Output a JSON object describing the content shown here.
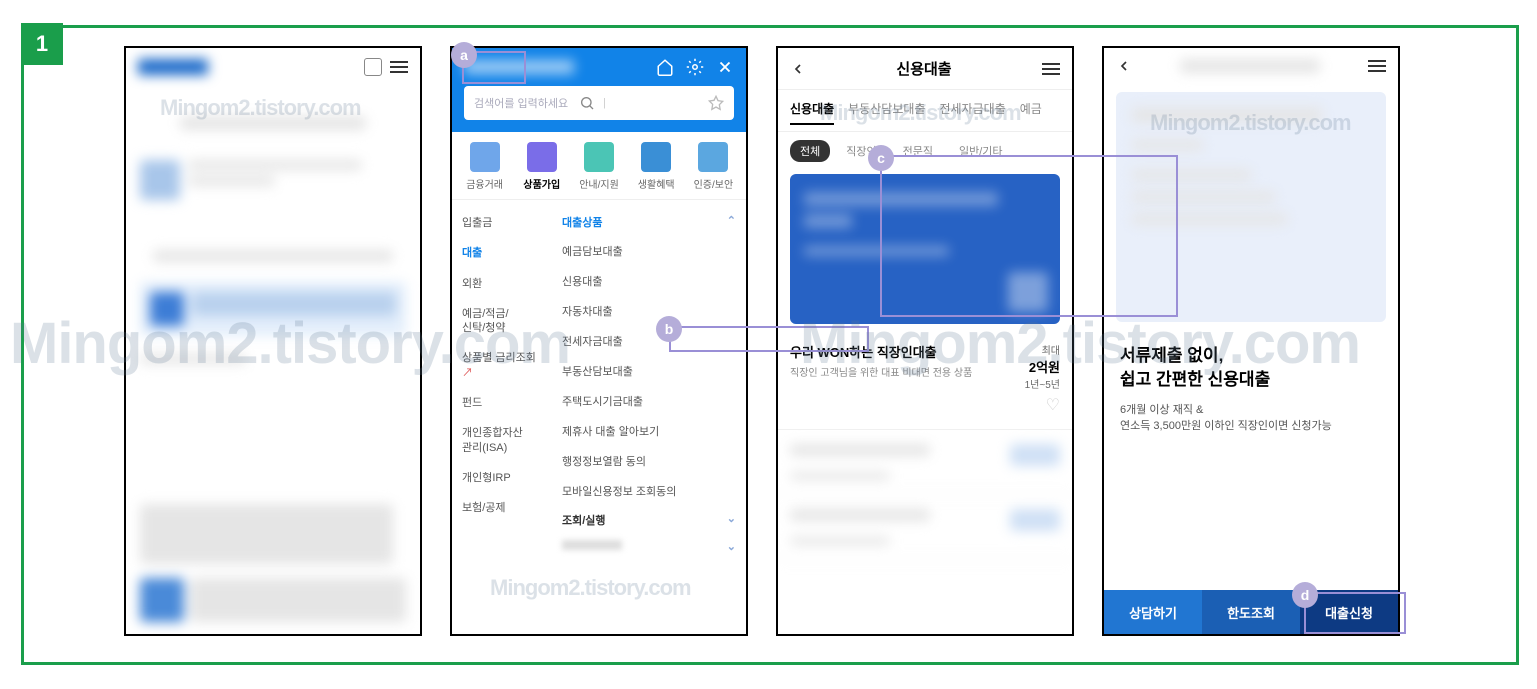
{
  "badge": "1",
  "watermark": "Mingom2.tistory.com",
  "annot_labels": {
    "a": "a",
    "b": "b",
    "c": "c",
    "d": "d"
  },
  "phone2": {
    "search_placeholder": "검색어를 입력하세요",
    "tabs": [
      "금융거래",
      "상품가입",
      "안내/지원",
      "생활혜택",
      "인증/보안"
    ],
    "left": [
      "입출금",
      "대출",
      "외환",
      "예금/적금/\n신탁/청약",
      "상품별 금리조회",
      "펀드",
      "개인종합자산\n관리(ISA)",
      "개인형IRP",
      "보험/공제"
    ],
    "right_head": "대출상품",
    "right": [
      "예금담보대출",
      "신용대출",
      "자동차대출",
      "전세자금대출",
      "부동산담보대출",
      "주택도시기금대출",
      "제휴사 대출 알아보기",
      "행정정보열람 동의",
      "모바일신용정보 조회동의"
    ],
    "right_head2": "조회/실행"
  },
  "phone3": {
    "title": "신용대출",
    "tabs1": [
      "신용대출",
      "부동산담보대출",
      "전세자금대출",
      "예금"
    ],
    "tabs2": [
      "전체",
      "직장인",
      "전문직",
      "일반/기타"
    ],
    "item1": {
      "name": "우리 WON하는 직장인대출",
      "sub": "직장인 고객님을 위한 대표 비대면 전용 상품",
      "max_label": "최대",
      "max": "2억원",
      "term": "1년~5년"
    }
  },
  "phone4": {
    "h1": "서류제출 없이,",
    "h2": "쉽고 간편한 신용대출",
    "sub1": "6개월 이상 재직 &",
    "sub2": "연소득 3,500만원 이하인 직장인이면 신청가능",
    "btns": [
      "상담하기",
      "한도조회",
      "대출신청"
    ]
  }
}
